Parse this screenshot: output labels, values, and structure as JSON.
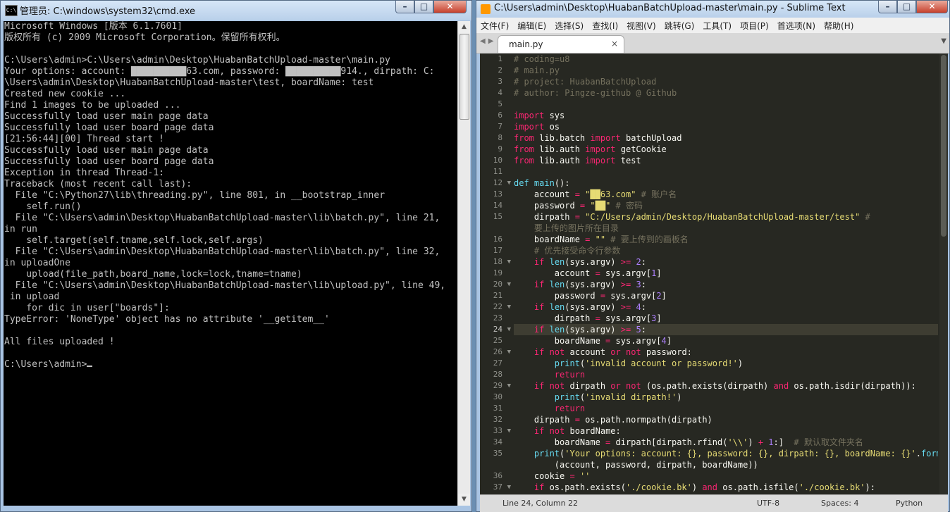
{
  "cmd": {
    "title": "管理员: C:\\windows\\system32\\cmd.exe",
    "icon_text": "C:\\",
    "lines": [
      "Microsoft Windows [版本 6.1.7601]",
      "版权所有 (c) 2009 Microsoft Corporation。保留所有权利。",
      "",
      "C:\\Users\\admin>C:\\Users\\admin\\Desktop\\HuabanBatchUpload-master\\main.py",
      "Your options: account: ██████████63.com, password: ██████████914., dirpath: C:",
      "\\Users\\admin\\Desktop\\HuabanBatchUpload-master\\test, boardName: test",
      "Created new cookie ...",
      "Find 1 images to be uploaded ...",
      "Successfully load user main page data",
      "Successfully load user board page data",
      "[21:56:44][00] Thread start !",
      "Successfully load user main page data",
      "Successfully load user board page data",
      "Exception in thread Thread-1:",
      "Traceback (most recent call last):",
      "  File \"C:\\Python27\\lib\\threading.py\", line 801, in __bootstrap_inner",
      "    self.run()",
      "  File \"C:\\Users\\admin\\Desktop\\HuabanBatchUpload-master\\lib\\batch.py\", line 21,",
      "in run",
      "    self.target(self.tname,self.lock,self.args)",
      "  File \"C:\\Users\\admin\\Desktop\\HuabanBatchUpload-master\\lib\\batch.py\", line 32,",
      "in uploadOne",
      "    upload(file_path,board_name,lock=lock,tname=tname)",
      "  File \"C:\\Users\\admin\\Desktop\\HuabanBatchUpload-master\\lib\\upload.py\", line 49,",
      " in upload",
      "    for dic in user[\"boards\"]:",
      "TypeError: 'NoneType' object has no attribute '__getitem__'",
      "",
      "All files uploaded !",
      "",
      "C:\\Users\\admin>"
    ]
  },
  "sublime": {
    "title": "C:\\Users\\admin\\Desktop\\HuabanBatchUpload-master\\main.py - Sublime Text",
    "menu": [
      "文件(F)",
      "编辑(E)",
      "选择(S)",
      "查找(I)",
      "视图(V)",
      "跳转(G)",
      "工具(T)",
      "项目(P)",
      "首选项(N)",
      "帮助(H)"
    ],
    "tab": {
      "label": "main.py",
      "close": "×"
    },
    "current_line": "24",
    "gutter": [
      {
        "n": "1"
      },
      {
        "n": "2"
      },
      {
        "n": "3"
      },
      {
        "n": "4"
      },
      {
        "n": "5"
      },
      {
        "n": "6"
      },
      {
        "n": "7"
      },
      {
        "n": "8"
      },
      {
        "n": "9"
      },
      {
        "n": "10"
      },
      {
        "n": "11"
      },
      {
        "n": "12",
        "fold": true
      },
      {
        "n": "13"
      },
      {
        "n": "14"
      },
      {
        "n": "15"
      },
      {
        "n": ""
      },
      {
        "n": "16"
      },
      {
        "n": "17"
      },
      {
        "n": "18",
        "fold": true
      },
      {
        "n": "19"
      },
      {
        "n": "20",
        "fold": true
      },
      {
        "n": "21"
      },
      {
        "n": "22",
        "fold": true
      },
      {
        "n": "23"
      },
      {
        "n": "24",
        "fold": true
      },
      {
        "n": "25"
      },
      {
        "n": "26",
        "fold": true
      },
      {
        "n": "27"
      },
      {
        "n": "28"
      },
      {
        "n": "29",
        "fold": true
      },
      {
        "n": "30"
      },
      {
        "n": "31"
      },
      {
        "n": "32"
      },
      {
        "n": "33",
        "fold": true
      },
      {
        "n": "34"
      },
      {
        "n": "35"
      },
      {
        "n": ""
      },
      {
        "n": "36"
      },
      {
        "n": "37",
        "fold": true
      }
    ],
    "code": [
      [
        [
          "c",
          "# coding=u8"
        ]
      ],
      [
        [
          "c",
          "# main.py"
        ]
      ],
      [
        [
          "c",
          "# project: HuabanBatchUpload"
        ]
      ],
      [
        [
          "c",
          "# author: Pingze-github @ Github"
        ]
      ],
      [],
      [
        [
          "k",
          "import"
        ],
        [
          "p",
          " sys"
        ]
      ],
      [
        [
          "k",
          "import"
        ],
        [
          "p",
          " os"
        ]
      ],
      [
        [
          "k",
          "from"
        ],
        [
          "p",
          " lib.batch "
        ],
        [
          "k",
          "import"
        ],
        [
          "p",
          " batchUpload"
        ]
      ],
      [
        [
          "k",
          "from"
        ],
        [
          "p",
          " lib.auth "
        ],
        [
          "k",
          "import"
        ],
        [
          "p",
          " getCookie"
        ]
      ],
      [
        [
          "k",
          "from"
        ],
        [
          "p",
          " lib.auth "
        ],
        [
          "k",
          "import"
        ],
        [
          "p",
          " test"
        ]
      ],
      [],
      [
        [
          "b",
          "def"
        ],
        [
          "p",
          " "
        ],
        [
          "b",
          "main"
        ],
        [
          "p",
          "():"
        ]
      ],
      [
        [
          "p",
          "    account "
        ],
        [
          "k",
          "="
        ],
        [
          "p",
          " "
        ],
        [
          "s",
          "\"██63.com\""
        ],
        [
          "c",
          " # 账户名"
        ]
      ],
      [
        [
          "p",
          "    password "
        ],
        [
          "k",
          "="
        ],
        [
          "p",
          " "
        ],
        [
          "s",
          "\"██\""
        ],
        [
          "c",
          " # 密码"
        ]
      ],
      [
        [
          "p",
          "    dirpath "
        ],
        [
          "k",
          "="
        ],
        [
          "p",
          " "
        ],
        [
          "s",
          "\"C:/Users/admin/Desktop/HuabanBatchUpload-master/test\""
        ],
        [
          "c",
          " #"
        ]
      ],
      [
        [
          "c",
          "    要上传的图片所在目录"
        ]
      ],
      [
        [
          "p",
          "    boardName "
        ],
        [
          "k",
          "="
        ],
        [
          "p",
          " "
        ],
        [
          "s",
          "\"\""
        ],
        [
          "c",
          " # 要上传到的画板名"
        ]
      ],
      [
        [
          "c",
          "    # 优先接受命令行参数"
        ]
      ],
      [
        [
          "p",
          "    "
        ],
        [
          "k",
          "if"
        ],
        [
          "p",
          " "
        ],
        [
          "b",
          "len"
        ],
        [
          "p",
          "(sys.argv) "
        ],
        [
          "k",
          ">="
        ],
        [
          "p",
          " "
        ],
        [
          "n",
          "2"
        ],
        [
          "p",
          ":"
        ]
      ],
      [
        [
          "p",
          "        account "
        ],
        [
          "k",
          "="
        ],
        [
          "p",
          " sys.argv["
        ],
        [
          "n",
          "1"
        ],
        [
          "p",
          "]"
        ]
      ],
      [
        [
          "p",
          "    "
        ],
        [
          "k",
          "if"
        ],
        [
          "p",
          " "
        ],
        [
          "b",
          "len"
        ],
        [
          "p",
          "(sys.argv) "
        ],
        [
          "k",
          ">="
        ],
        [
          "p",
          " "
        ],
        [
          "n",
          "3"
        ],
        [
          "p",
          ":"
        ]
      ],
      [
        [
          "p",
          "        password "
        ],
        [
          "k",
          "="
        ],
        [
          "p",
          " sys.argv["
        ],
        [
          "n",
          "2"
        ],
        [
          "p",
          "]"
        ]
      ],
      [
        [
          "p",
          "    "
        ],
        [
          "k",
          "if"
        ],
        [
          "p",
          " "
        ],
        [
          "b",
          "len"
        ],
        [
          "p",
          "(sys.argv) "
        ],
        [
          "k",
          ">="
        ],
        [
          "p",
          " "
        ],
        [
          "n",
          "4"
        ],
        [
          "p",
          ":"
        ]
      ],
      [
        [
          "p",
          "        dirpath "
        ],
        [
          "k",
          "="
        ],
        [
          "p",
          " sys.argv["
        ],
        [
          "n",
          "3"
        ],
        [
          "p",
          "]"
        ]
      ],
      [
        [
          "p",
          "    "
        ],
        [
          "k",
          "if"
        ],
        [
          "p",
          " "
        ],
        [
          "b",
          "len"
        ],
        [
          "p",
          "(sys.argv) "
        ],
        [
          "k",
          ">="
        ],
        [
          "p",
          " "
        ],
        [
          "n",
          "5"
        ],
        [
          "p",
          ":"
        ]
      ],
      [
        [
          "p",
          "        boardName "
        ],
        [
          "k",
          "="
        ],
        [
          "p",
          " sys.argv["
        ],
        [
          "n",
          "4"
        ],
        [
          "p",
          "]"
        ]
      ],
      [
        [
          "p",
          "    "
        ],
        [
          "k",
          "if not"
        ],
        [
          "p",
          " account "
        ],
        [
          "k",
          "or not"
        ],
        [
          "p",
          " password:"
        ]
      ],
      [
        [
          "p",
          "        "
        ],
        [
          "b",
          "print"
        ],
        [
          "p",
          "("
        ],
        [
          "s",
          "'invalid account or password!'"
        ],
        [
          "p",
          ")"
        ]
      ],
      [
        [
          "p",
          "        "
        ],
        [
          "k",
          "return"
        ]
      ],
      [
        [
          "p",
          "    "
        ],
        [
          "k",
          "if not"
        ],
        [
          "p",
          " dirpath "
        ],
        [
          "k",
          "or not"
        ],
        [
          "p",
          " (os.path.exists(dirpath) "
        ],
        [
          "k",
          "and"
        ],
        [
          "p",
          " os.path.isdir(dirpath)):"
        ]
      ],
      [
        [
          "p",
          "        "
        ],
        [
          "b",
          "print"
        ],
        [
          "p",
          "("
        ],
        [
          "s",
          "'invalid dirpath!'"
        ],
        [
          "p",
          ")"
        ]
      ],
      [
        [
          "p",
          "        "
        ],
        [
          "k",
          "return"
        ]
      ],
      [
        [
          "p",
          "    dirpath "
        ],
        [
          "k",
          "="
        ],
        [
          "p",
          " os.path.normpath(dirpath)"
        ]
      ],
      [
        [
          "p",
          "    "
        ],
        [
          "k",
          "if not"
        ],
        [
          "p",
          " boardName:"
        ]
      ],
      [
        [
          "p",
          "        boardName "
        ],
        [
          "k",
          "="
        ],
        [
          "p",
          " dirpath[dirpath.rfind("
        ],
        [
          "s",
          "'\\\\'"
        ],
        [
          "p",
          ") "
        ],
        [
          "k",
          "+"
        ],
        [
          "p",
          " "
        ],
        [
          "n",
          "1"
        ],
        [
          "p",
          ":]  "
        ],
        [
          "c",
          "# 默认取文件夹名"
        ]
      ],
      [
        [
          "p",
          "    "
        ],
        [
          "b",
          "print"
        ],
        [
          "p",
          "("
        ],
        [
          "s",
          "'Your options: account: {}, password: {}, dirpath: {}, boardName: {}'"
        ],
        [
          "p",
          "."
        ],
        [
          "b",
          "format"
        ]
      ],
      [
        [
          "p",
          "        (account, password, dirpath, boardName))"
        ]
      ],
      [
        [
          "p",
          "    cookie "
        ],
        [
          "k",
          "="
        ],
        [
          "p",
          " "
        ],
        [
          "s",
          "''"
        ]
      ],
      [
        [
          "p",
          "    "
        ],
        [
          "k",
          "if"
        ],
        [
          "p",
          " os.path.exists("
        ],
        [
          "s",
          "'./cookie.bk'"
        ],
        [
          "p",
          ") "
        ],
        [
          "k",
          "and"
        ],
        [
          "p",
          " os.path.isfile("
        ],
        [
          "s",
          "'./cookie.bk'"
        ],
        [
          "p",
          "):"
        ]
      ]
    ],
    "status": {
      "position": "Line 24, Column 22",
      "encoding": "UTF-8",
      "spaces": "Spaces: 4",
      "syntax": "Python"
    }
  }
}
